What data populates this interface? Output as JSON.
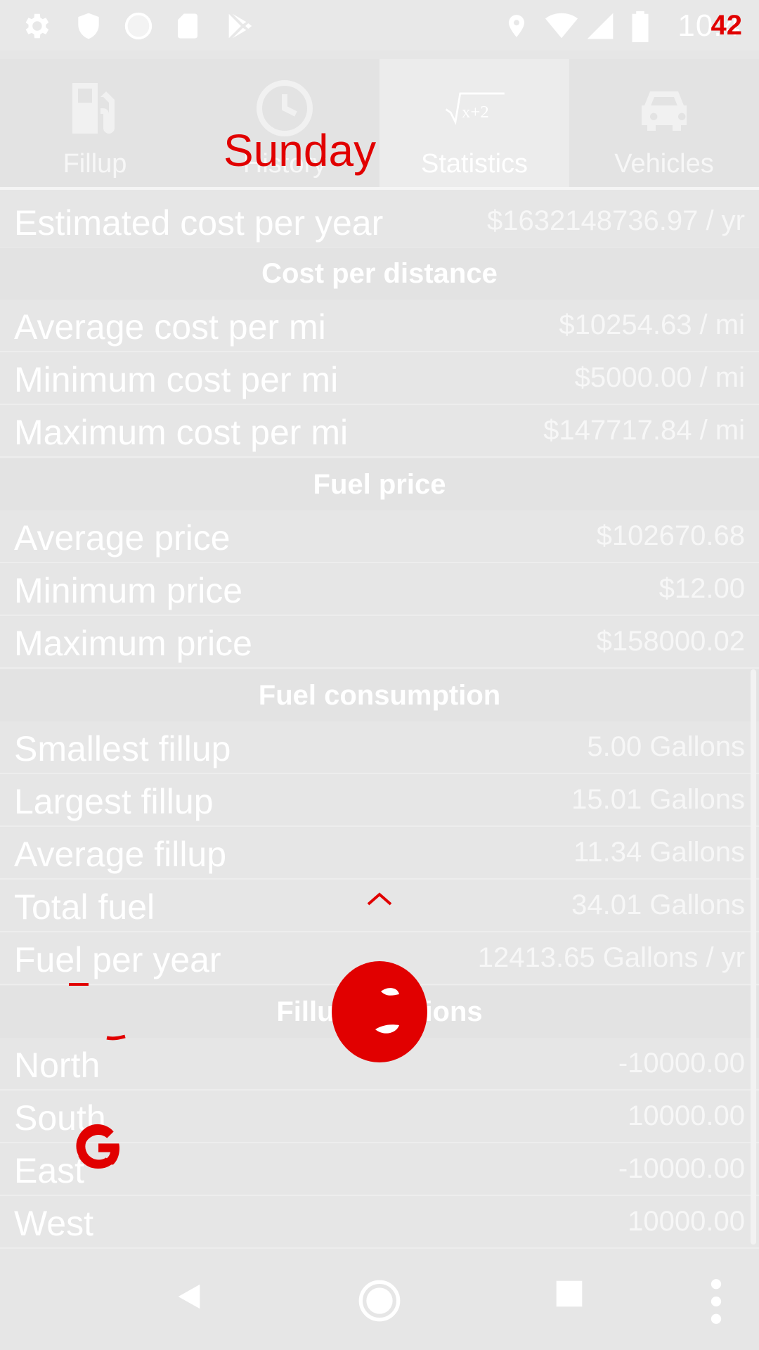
{
  "status_bar": {
    "time": "10:4",
    "time_overlay": "42",
    "left_icons": [
      "gear-icon",
      "shield-icon",
      "circle-icon",
      "sd-card-icon",
      "play-store-icon"
    ],
    "right_icons": [
      "location-icon",
      "wifi-icon",
      "signal-icon",
      "battery-icon"
    ]
  },
  "tabs": [
    {
      "label": "Fillup",
      "icon": "fuel-pump-icon",
      "active": false
    },
    {
      "label": "History",
      "icon": "clock-icon",
      "active": false
    },
    {
      "label": "Statistics",
      "icon": "formula-icon",
      "active": true
    },
    {
      "label": "Vehicles",
      "icon": "car-icon",
      "active": false
    }
  ],
  "overlay_text": "Sunday",
  "statistics": {
    "estimated_cost": {
      "label": "Estimated cost per year",
      "value": "$1632148736.97 / yr"
    },
    "cost_per_distance": {
      "title": "Cost per distance",
      "rows": [
        {
          "label": "Average cost per mi",
          "value": "$10254.63 / mi"
        },
        {
          "label": "Minimum cost per mi",
          "value": "$5000.00 / mi"
        },
        {
          "label": "Maximum cost per mi",
          "value": "$147717.84 / mi"
        }
      ]
    },
    "fuel_price": {
      "title": "Fuel price",
      "rows": [
        {
          "label": "Average price",
          "value": "$102670.68"
        },
        {
          "label": "Minimum price",
          "value": "$12.00"
        },
        {
          "label": "Maximum price",
          "value": "$158000.02"
        }
      ]
    },
    "fuel_consumption": {
      "title": "Fuel consumption",
      "rows": [
        {
          "label": "Smallest fillup",
          "value": "5.00 Gallons"
        },
        {
          "label": "Largest fillup",
          "value": "15.01 Gallons"
        },
        {
          "label": "Average fillup",
          "value": "11.34 Gallons"
        },
        {
          "label": "Total fuel",
          "value": "34.01 Gallons"
        },
        {
          "label": "Fuel per year",
          "value": "12413.65 Gallons / yr"
        }
      ]
    },
    "fillup_locations": {
      "title": "Fillup locations",
      "rows": [
        {
          "label": "North",
          "value": "-10000.00"
        },
        {
          "label": "South",
          "value": "10000.00"
        },
        {
          "label": "East",
          "value": "-10000.00"
        },
        {
          "label": "West",
          "value": "10000.00"
        }
      ]
    }
  },
  "overlay_icons": [
    "chevron-up-icon",
    "red-circle-icon",
    "google-g-icon",
    "red-fragment-icon"
  ],
  "nav_bar": [
    "back-icon",
    "home-icon",
    "recents-icon",
    "more-icon"
  ]
}
